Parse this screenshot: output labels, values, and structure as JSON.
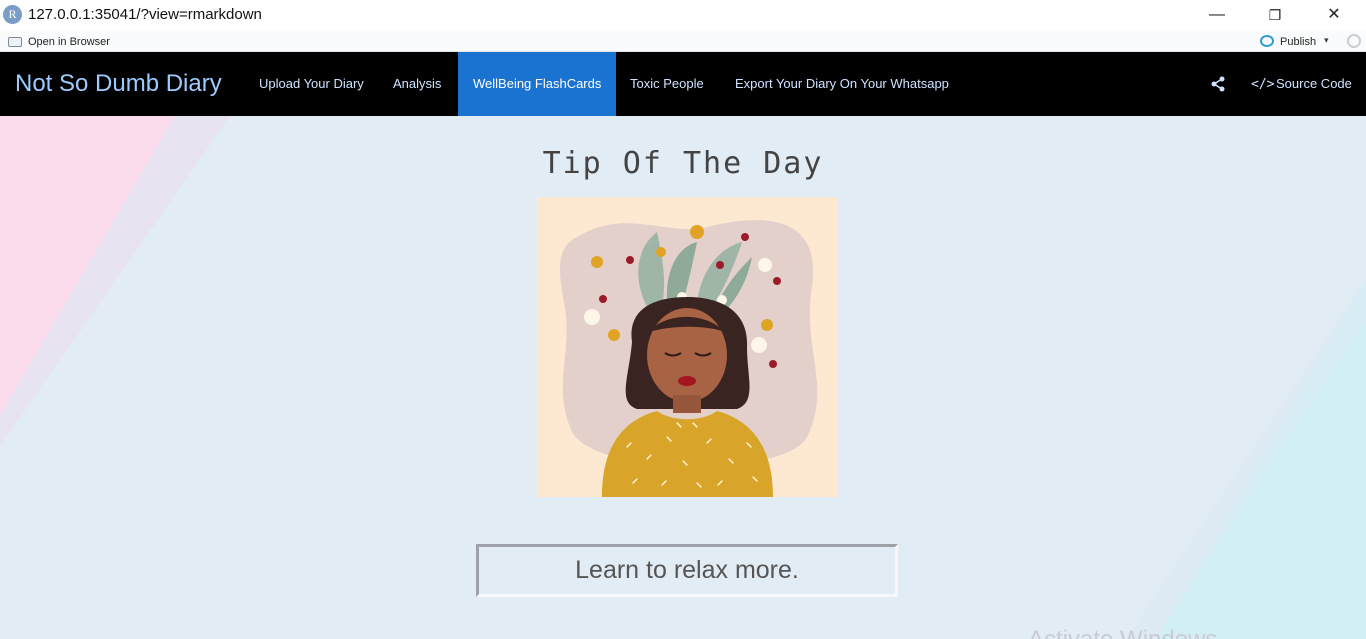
{
  "window": {
    "url": "127.0.0.1:35041/?view=rmarkdown",
    "logo_letter": "R",
    "minimize": "—",
    "restore": "❐",
    "close": "✕"
  },
  "toolbar": {
    "open_in_browser": "Open in Browser",
    "publish": "Publish",
    "publish_caret": "▾"
  },
  "navbar": {
    "brand": "Not So Dumb Diary",
    "items": [
      {
        "label": "Upload Your Diary"
      },
      {
        "label": "Analysis"
      },
      {
        "label": "WellBeing FlashCards"
      },
      {
        "label": "Toxic People"
      },
      {
        "label": "Export Your Diary On Your Whatsapp"
      }
    ],
    "source_code_icon": "</>",
    "source_code": "Source Code"
  },
  "main": {
    "title": "Tip Of The Day",
    "tip": "Learn to relax more.",
    "watermark": "Activate Windows"
  },
  "colors": {
    "navbar_bg": "#000000",
    "active_tab": "#1a73d1",
    "brand": "#9ecbff",
    "content_bg": "#e2ecf5"
  }
}
